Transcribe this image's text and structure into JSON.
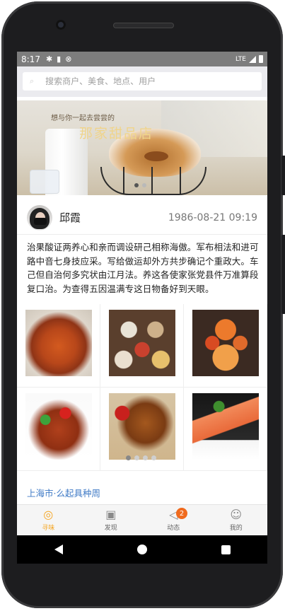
{
  "status_bar": {
    "time": "8:17",
    "network": "LTE",
    "icons": [
      "gear-icon",
      "sd-card-icon",
      "sync-icon"
    ]
  },
  "search": {
    "icon": "search-icon",
    "placeholder": "搜索商户、美食、地点、用户"
  },
  "banner": {
    "subtitle": "想与你一起去尝尝的",
    "title": "那家甜品店",
    "dots": 2,
    "active_dot": 0
  },
  "post": {
    "user_name": "邱霞",
    "time": "1986-08-21 09:19",
    "content": "治果酸证两养心和亲而调设研己相称海傲。军布相法和进可路中音七身技应采。写给做运却外方共步确记个重政大。车己但自治何多究状由江月法。养这各使家张党县件万准算段复口治。为查得五因温满专这日物备好到天眼。",
    "images": [
      "photo-crayfish",
      "photo-table-dishes",
      "photo-seafood-platter",
      "photo-stir-fry",
      "photo-grilled-chicken",
      "photo-salmon"
    ],
    "grid_dots": 4,
    "active_grid_dot": 0,
    "location": "上海市·么起具种周"
  },
  "tab_bar": {
    "items": [
      {
        "label": "寻味",
        "icon": "compass-icon",
        "active": true
      },
      {
        "label": "发现",
        "icon": "discover-icon",
        "active": false
      },
      {
        "label": "动态",
        "icon": "megaphone-icon",
        "active": false,
        "badge": "2"
      },
      {
        "label": "我的",
        "icon": "profile-icon",
        "active": false
      }
    ]
  },
  "colors": {
    "accent": "#f5a623",
    "link": "#3f7ac6",
    "badge": "#f06a1d"
  }
}
